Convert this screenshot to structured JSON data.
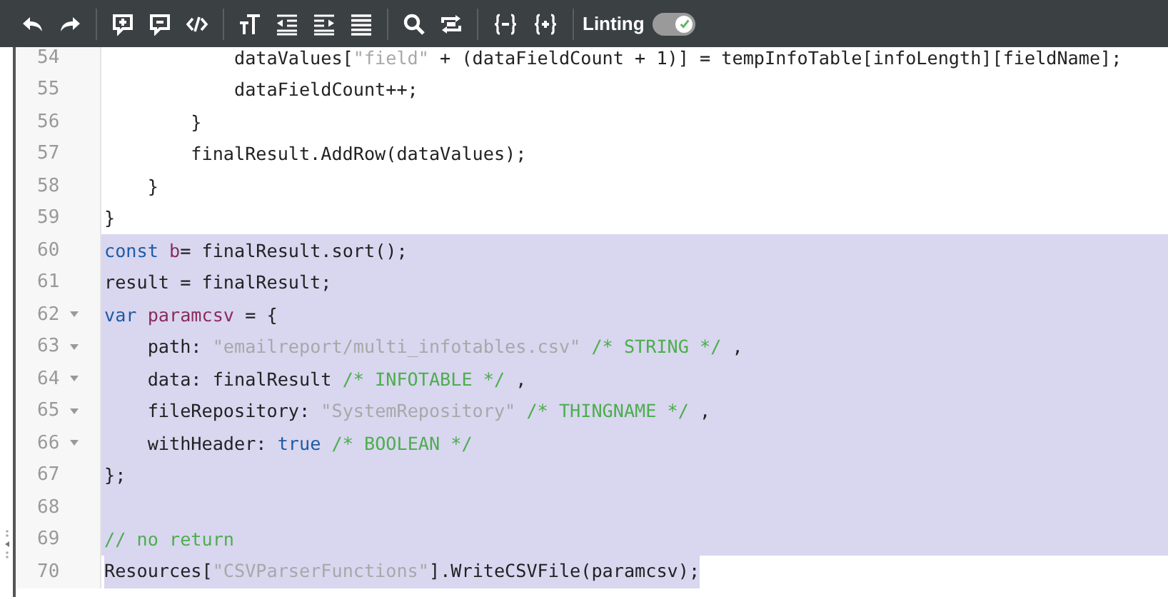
{
  "toolbar": {
    "linting": {
      "label": "Linting",
      "on": true
    }
  },
  "lines": [
    {
      "number": "54",
      "foldable": false,
      "selected": false,
      "tokens": [
        {
          "kind": "plain",
          "text": "            dataValues["
        },
        {
          "kind": "string",
          "text": "\"field\""
        },
        {
          "kind": "plain",
          "text": " + (dataFieldCount + 1)] = tempInfoTable[infoLength][fieldName];"
        }
      ]
    },
    {
      "number": "55",
      "foldable": false,
      "selected": false,
      "tokens": [
        {
          "kind": "plain",
          "text": "            dataFieldCount++;"
        }
      ]
    },
    {
      "number": "56",
      "foldable": false,
      "selected": false,
      "tokens": [
        {
          "kind": "plain",
          "text": "        }"
        }
      ]
    },
    {
      "number": "57",
      "foldable": false,
      "selected": false,
      "tokens": [
        {
          "kind": "plain",
          "text": "        finalResult.AddRow(dataValues);"
        }
      ]
    },
    {
      "number": "58",
      "foldable": false,
      "selected": false,
      "tokens": [
        {
          "kind": "plain",
          "text": "    }"
        }
      ]
    },
    {
      "number": "59",
      "foldable": false,
      "selected": false,
      "tokens": [
        {
          "kind": "plain",
          "text": "}"
        }
      ]
    },
    {
      "number": "60",
      "foldable": false,
      "selected": true,
      "tokens": [
        {
          "kind": "keyword",
          "text": "const"
        },
        {
          "kind": "variable",
          "text": " b"
        },
        {
          "kind": "plain",
          "text": "= finalResult.sort();"
        }
      ]
    },
    {
      "number": "61",
      "foldable": false,
      "selected": true,
      "tokens": [
        {
          "kind": "plain",
          "text": "result = finalResult;"
        }
      ]
    },
    {
      "number": "62",
      "foldable": true,
      "selected": true,
      "tokens": [
        {
          "kind": "keyword",
          "text": "var"
        },
        {
          "kind": "variable",
          "text": " paramcsv"
        },
        {
          "kind": "plain",
          "text": " = {"
        }
      ]
    },
    {
      "number": "63",
      "foldable": true,
      "selected": true,
      "tokens": [
        {
          "kind": "plain",
          "text": "    path: "
        },
        {
          "kind": "string",
          "text": "\"emailreport/multi_infotables.csv\""
        },
        {
          "kind": "comment",
          "text": " /* STRING */"
        },
        {
          "kind": "plain",
          "text": " ,"
        }
      ]
    },
    {
      "number": "64",
      "foldable": true,
      "selected": true,
      "tokens": [
        {
          "kind": "plain",
          "text": "    data: finalResult "
        },
        {
          "kind": "comment",
          "text": "/* INFOTABLE */"
        },
        {
          "kind": "plain",
          "text": " ,"
        }
      ]
    },
    {
      "number": "65",
      "foldable": true,
      "selected": true,
      "tokens": [
        {
          "kind": "plain",
          "text": "    fileRepository: "
        },
        {
          "kind": "string",
          "text": "\"SystemRepository\""
        },
        {
          "kind": "comment",
          "text": " /* THINGNAME */"
        },
        {
          "kind": "plain",
          "text": " ,"
        }
      ]
    },
    {
      "number": "66",
      "foldable": true,
      "selected": true,
      "tokens": [
        {
          "kind": "plain",
          "text": "    withHeader: "
        },
        {
          "kind": "keyword",
          "text": "true"
        },
        {
          "kind": "comment",
          "text": " /* BOOLEAN */"
        }
      ]
    },
    {
      "number": "67",
      "foldable": false,
      "selected": true,
      "tokens": [
        {
          "kind": "plain",
          "text": "};"
        }
      ]
    },
    {
      "number": "68",
      "foldable": false,
      "selected": true
    },
    {
      "number": "69",
      "foldable": false,
      "selected": true,
      "tokens": [
        {
          "kind": "comment",
          "text": "// no return"
        }
      ]
    },
    {
      "number": "70",
      "foldable": false,
      "selected": true,
      "tokens": [
        {
          "kind": "plain",
          "text": "Resources["
        },
        {
          "kind": "string",
          "text": "\"CSVParserFunctions\""
        },
        {
          "kind": "plain",
          "text": "].WriteCSVFile(paramcsv);"
        }
      ]
    }
  ]
}
